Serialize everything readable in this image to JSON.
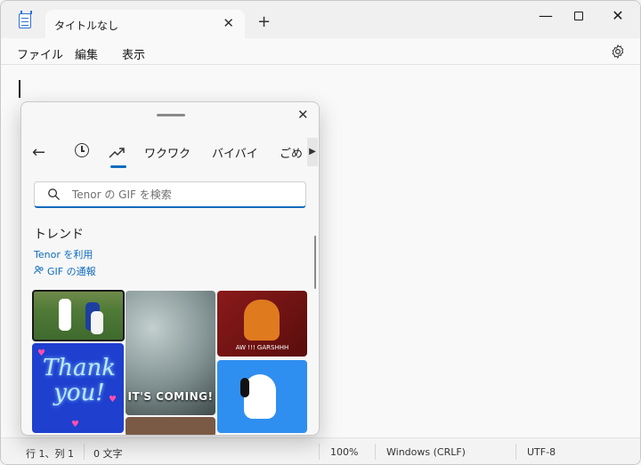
{
  "window": {
    "tab_title": "タイトルなし",
    "tab_close": "✕",
    "new_tab": "+",
    "minimize": "—",
    "close": "✕"
  },
  "menu": {
    "file": "ファイル",
    "edit": "編集",
    "view": "表示"
  },
  "status": {
    "position": "行 1、列 1",
    "chars": "0 文字",
    "zoom": "100%",
    "line_ending": "Windows (CRLF)",
    "encoding": "UTF-8"
  },
  "gif_panel": {
    "close": "✕",
    "back": "←",
    "categories": [
      "ワクワク",
      "バイバイ",
      "ごめ"
    ],
    "scroll_right": "▶",
    "search_placeholder": "Tenor の GIF を検索",
    "heading": "トレンド",
    "tenor_link": "Tenor を利用",
    "report_link": "GIF の通報",
    "gifs": {
      "coming_caption": "IT'S COMING!",
      "garsh_caption": "AW !!! GARSHHH",
      "thank_text": "Thank you!"
    }
  }
}
